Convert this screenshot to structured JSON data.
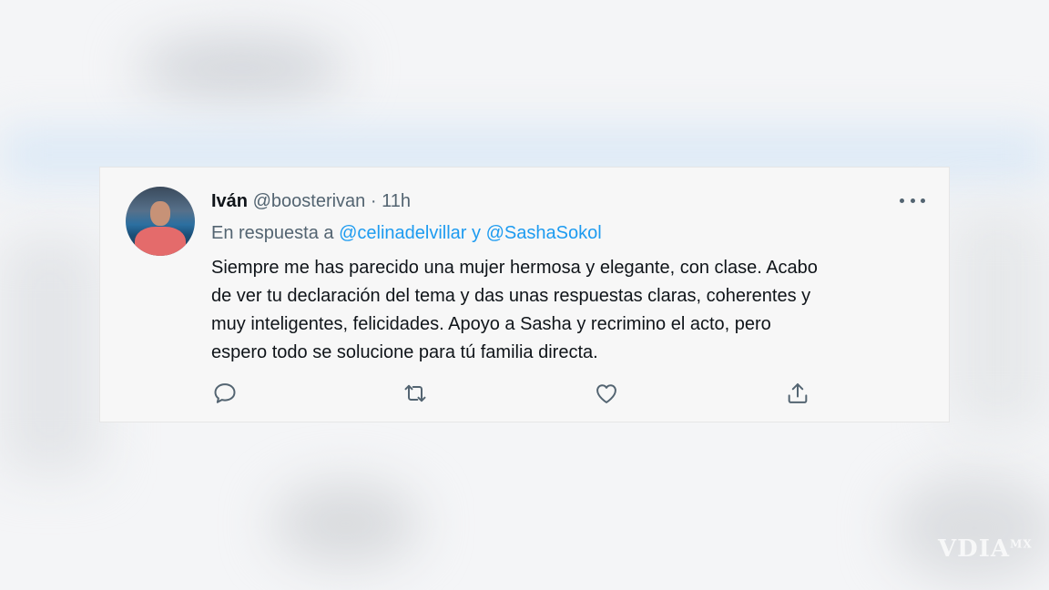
{
  "tweet": {
    "author_name": "Iván",
    "handle": "@boosterivan",
    "separator": "·",
    "time": "11h",
    "reply_prefix": "En respuesta a",
    "mention_1": "@celinadelvillar",
    "reply_joiner": "y",
    "mention_2": "@SashaSokol",
    "body_lines": [
      "Siempre me has parecido una mujer hermosa y elegante, con clase. Acabo",
      "de ver tu declaración del tema y das unas respuestas claras, coherentes y",
      "muy inteligentes, felicidades. Apoyo a Sasha y recrimino el acto, pero",
      "espero todo se solucione para tú familia directa."
    ]
  },
  "actions": {
    "reply_icon": "reply-icon",
    "retweet_icon": "retweet-icon",
    "like_icon": "heart-icon",
    "share_icon": "share-icon"
  },
  "colors": {
    "mention": "#1d9bf0",
    "secondary_text": "#536471",
    "primary_text": "#0f1419"
  },
  "watermark": {
    "text": "VDIA",
    "suffix": "MX"
  }
}
